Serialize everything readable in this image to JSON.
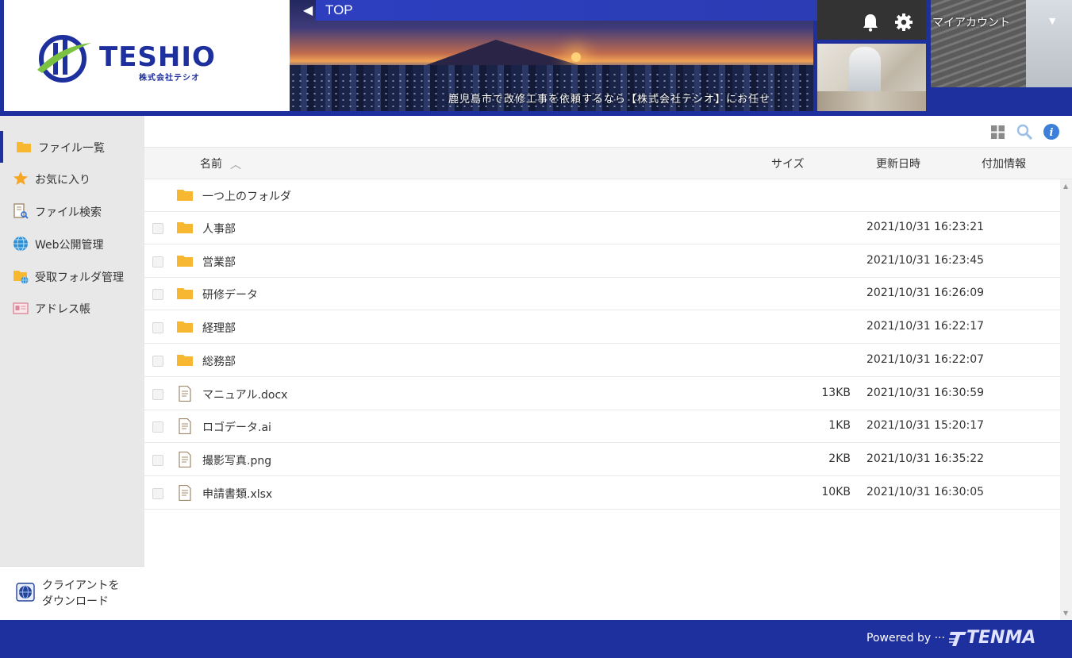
{
  "header": {
    "logo_text": "TESHIO",
    "logo_sub": "株式会社テシオ",
    "breadcrumb": "TOP",
    "banner_caption": "鹿児島市で改修工事を依頼するなら【株式会社テシオ】にお任せ",
    "account_label": "マイアカウント",
    "brand_color": "#1e2f9e"
  },
  "sidebar": {
    "items": [
      {
        "label": "ファイル一覧",
        "icon": "folder-icon"
      },
      {
        "label": "お気に入り",
        "icon": "star-icon"
      },
      {
        "label": "ファイル検索",
        "icon": "file-search-icon"
      },
      {
        "label": "Web公開管理",
        "icon": "globe-icon"
      },
      {
        "label": "受取フォルダ管理",
        "icon": "receive-folder-icon"
      },
      {
        "label": "アドレス帳",
        "icon": "address-book-icon"
      }
    ],
    "download_line1": "クライアントを",
    "download_line2": "ダウンロード"
  },
  "table": {
    "columns": {
      "name": "名前",
      "size": "サイズ",
      "updated": "更新日時",
      "extra": "付加情報"
    },
    "parent_folder": "一つ上のフォルダ",
    "rows": [
      {
        "type": "folder",
        "name": "人事部",
        "size": "",
        "date": "2021/10/31 16:23:21"
      },
      {
        "type": "folder",
        "name": "営業部",
        "size": "",
        "date": "2021/10/31 16:23:45"
      },
      {
        "type": "folder",
        "name": "研修データ",
        "size": "",
        "date": "2021/10/31 16:26:09"
      },
      {
        "type": "folder",
        "name": "経理部",
        "size": "",
        "date": "2021/10/31 16:22:17"
      },
      {
        "type": "folder",
        "name": "総務部",
        "size": "",
        "date": "2021/10/31 16:22:07"
      },
      {
        "type": "file",
        "name": "マニュアル.docx",
        "size": "13KB",
        "date": "2021/10/31 16:30:59"
      },
      {
        "type": "file",
        "name": "ロゴデータ.ai",
        "size": "1KB",
        "date": "2021/10/31 15:20:17"
      },
      {
        "type": "file",
        "name": "撮影写真.png",
        "size": "2KB",
        "date": "2021/10/31 16:35:22"
      },
      {
        "type": "file",
        "name": "申請書類.xlsx",
        "size": "10KB",
        "date": "2021/10/31 16:30:05"
      }
    ]
  },
  "footer": {
    "powered_by": "Powered by ···",
    "brand": "TENMA"
  }
}
